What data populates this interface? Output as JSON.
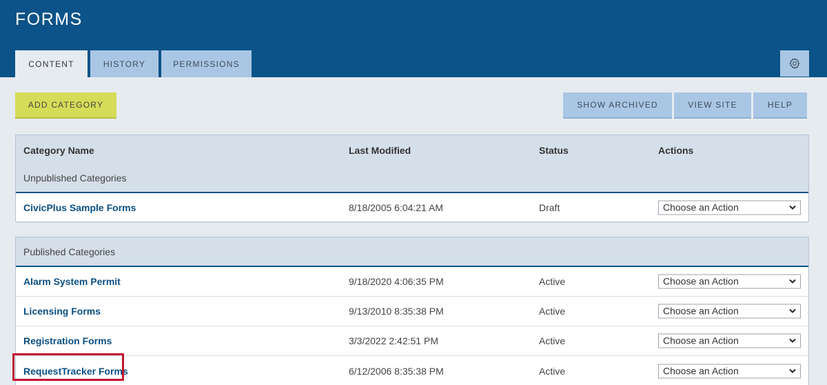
{
  "header": {
    "title": "FORMS",
    "tabs": [
      {
        "label": "CONTENT",
        "active": true
      },
      {
        "label": "HISTORY",
        "active": false
      },
      {
        "label": "PERMISSIONS",
        "active": false
      }
    ],
    "settings_icon": "gear-icon"
  },
  "toolbar": {
    "add_category": "ADD CATEGORY",
    "show_archived": "SHOW ARCHIVED",
    "view_site": "VIEW SITE",
    "help": "HELP"
  },
  "columns": {
    "name": "Category Name",
    "modified": "Last Modified",
    "status": "Status",
    "actions": "Actions"
  },
  "unpublished": {
    "label": "Unpublished Categories",
    "rows": [
      {
        "name": "CivicPlus Sample Forms",
        "modified": "8/18/2005 6:04:21 AM",
        "status": "Draft",
        "action": "Choose an Action"
      }
    ]
  },
  "published": {
    "label": "Published Categories",
    "rows": [
      {
        "name": "Alarm System Permit",
        "modified": "9/18/2020 4:06:35 PM",
        "status": "Active",
        "action": "Choose an Action"
      },
      {
        "name": "Licensing Forms",
        "modified": "9/13/2010 8:35:38 PM",
        "status": "Active",
        "action": "Choose an Action"
      },
      {
        "name": "Registration Forms",
        "modified": "3/3/2022 2:42:51 PM",
        "status": "Active",
        "action": "Choose an Action"
      },
      {
        "name": "RequestTracker Forms",
        "modified": "6/12/2006 8:35:38 PM",
        "status": "Active",
        "action": "Choose an Action"
      }
    ]
  },
  "colors": {
    "header_bg": "#0b5388",
    "tab_inactive": "#a9c6e4",
    "add_button": "#d5dc57",
    "highlight": "#c0152f"
  }
}
